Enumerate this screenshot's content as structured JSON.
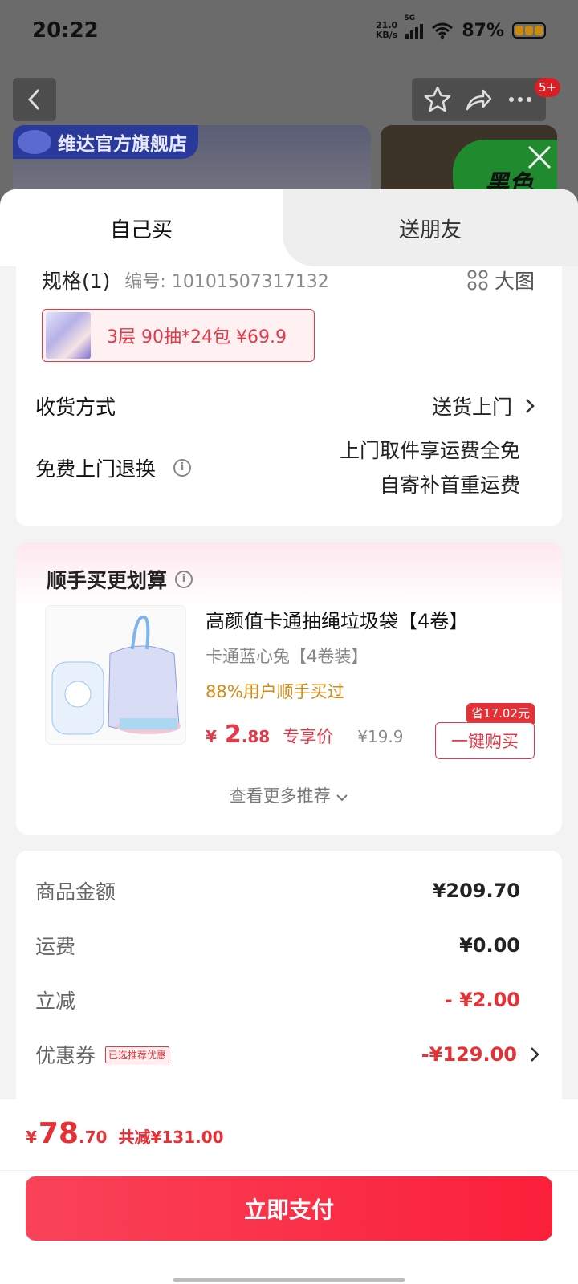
{
  "status_bar": {
    "time": "20:22",
    "net_speed_value": "21.0",
    "net_speed_unit": "KB/s",
    "network": "5G",
    "battery": "87%"
  },
  "background": {
    "store_name": "维达官方旗舰店",
    "side_text": "黑色",
    "notification_count": "5+"
  },
  "tabs": {
    "self": "自己买",
    "gift": "送朋友"
  },
  "spec": {
    "label": "规格(1)",
    "code": "编号: 10101507317132",
    "big_image": "大图",
    "sku_text": "3层 90抽*24包   ¥69.9"
  },
  "delivery": {
    "label": "收货方式",
    "value": "送货上门"
  },
  "returns": {
    "label": "免费上门退换",
    "line1": "上门取件享运费全免",
    "line2": "自寄补首重运费"
  },
  "bundle": {
    "title": "顺手买更划算",
    "product_name": "高颜值卡通抽绳垃圾袋【4卷】",
    "variant": "卡通蓝心兔【4卷装】",
    "buy_rate": "88%用户顺手买过",
    "price_yen": "¥",
    "price_int": "2",
    "price_dec": ".88",
    "price_tag": "专享价",
    "price_orig": "¥19.9",
    "save_badge": "省17.02元",
    "buy_button": "一键购买",
    "more": "查看更多推荐"
  },
  "summary": {
    "goods_label": "商品金额",
    "goods_value": "¥209.70",
    "shipping_label": "运费",
    "shipping_value": "¥0.00",
    "discount_label": "立减",
    "discount_value": "- ¥2.00",
    "coupon_label": "优惠券",
    "coupon_tag": "已选推荐优惠",
    "coupon_value": "-¥129.00"
  },
  "bottom": {
    "total_yen": "¥",
    "total_int": "78",
    "total_dec": ".70",
    "total_saved": "共减¥131.00",
    "pay_button": "立即支付"
  },
  "colors": {
    "accent": "#e53035",
    "pay_button": "#fb1f3a",
    "buy_rate": "#d48a14"
  }
}
